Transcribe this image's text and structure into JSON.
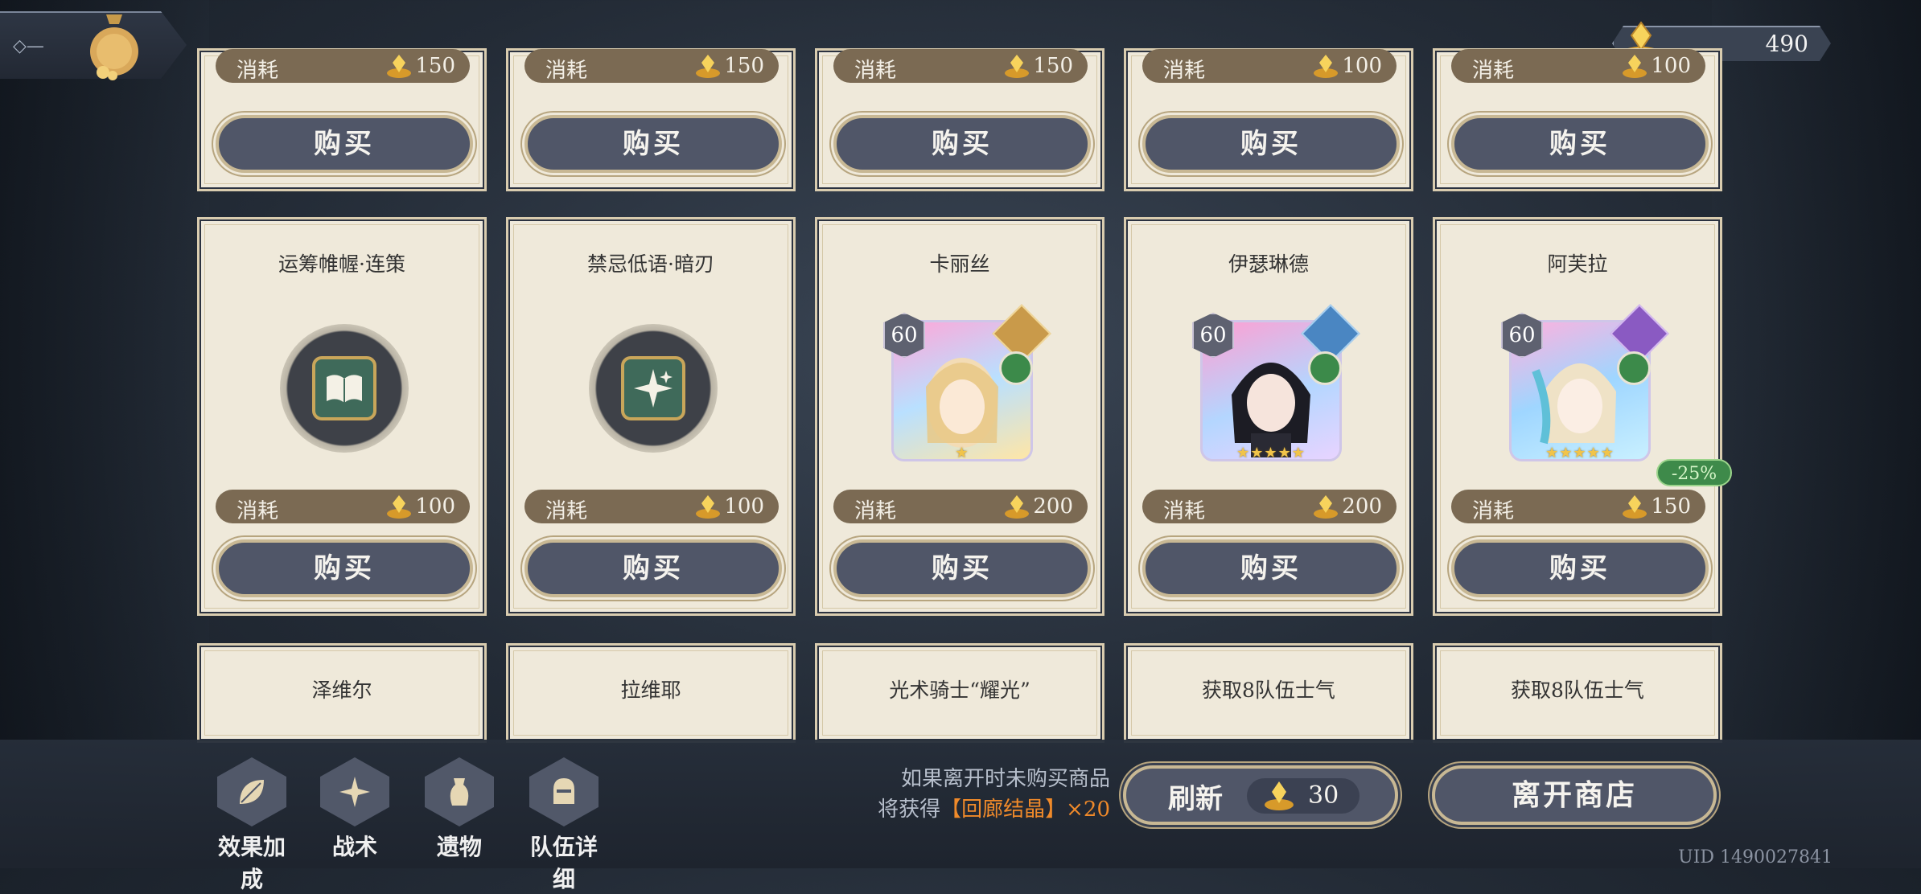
{
  "header": {
    "currency": {
      "icon": "crystal-coin-icon",
      "value": "490"
    },
    "bag_icon": "bag-icon"
  },
  "colors": {
    "card_bg": "#efe9da",
    "cost_bar": "#7b6a53",
    "button": "#505668",
    "highlight": "#f08a2a",
    "discount": "#3e8a4a"
  },
  "rows": [
    {
      "items": [
        {
          "name": "",
          "cost_label": "消耗",
          "cost": "150",
          "buy": "购买"
        },
        {
          "name": "",
          "cost_label": "消耗",
          "cost": "150",
          "buy": "购买"
        },
        {
          "name": "",
          "cost_label": "消耗",
          "cost": "150",
          "buy": "购买"
        },
        {
          "name": "",
          "cost_label": "消耗",
          "cost": "100",
          "buy": "购买"
        },
        {
          "name": "",
          "cost_label": "消耗",
          "cost": "100",
          "buy": "购买"
        }
      ]
    },
    {
      "items": [
        {
          "name": "运筹帷幄·连策",
          "type": "skill",
          "icon": "book-icon",
          "cost_label": "消耗",
          "cost": "100",
          "buy": "购买"
        },
        {
          "name": "禁忌低语·暗刃",
          "type": "skill",
          "icon": "sparkle-icon",
          "cost_label": "消耗",
          "cost": "100",
          "buy": "购买"
        },
        {
          "name": "卡丽丝",
          "type": "character",
          "level": "60",
          "stars": "★",
          "cost_label": "消耗",
          "cost": "200",
          "buy": "购买"
        },
        {
          "name": "伊瑟琳德",
          "type": "character",
          "level": "60",
          "stars": "★★★★★",
          "cost_label": "消耗",
          "cost": "200",
          "buy": "购买"
        },
        {
          "name": "阿芙拉",
          "type": "character",
          "level": "60",
          "stars": "★★★★★",
          "discount": "-25%",
          "cost_label": "消耗",
          "cost": "150",
          "buy": "购买"
        }
      ]
    },
    {
      "items": [
        {
          "name": "泽维尔"
        },
        {
          "name": "拉维耶"
        },
        {
          "name": "光术骑士“耀光”"
        },
        {
          "name": "获取8队伍士气"
        },
        {
          "name": "获取8队伍士气"
        }
      ]
    }
  ],
  "bottom_nav": [
    {
      "label": "效果加成",
      "icon": "leaf-icon"
    },
    {
      "label": "战术",
      "icon": "star-burst-icon"
    },
    {
      "label": "遗物",
      "icon": "vase-icon"
    },
    {
      "label": "队伍详细",
      "icon": "knight-helmet-icon"
    }
  ],
  "notice": {
    "line1": "如果离开时未购买商品",
    "line2_prefix": "将获得",
    "line2_highlight": "【回廊结晶】",
    "line2_suffix": "×20"
  },
  "refresh": {
    "label": "刷新",
    "cost": "30"
  },
  "leave": {
    "label": "离开商店"
  },
  "uid": "UID 1490027841"
}
